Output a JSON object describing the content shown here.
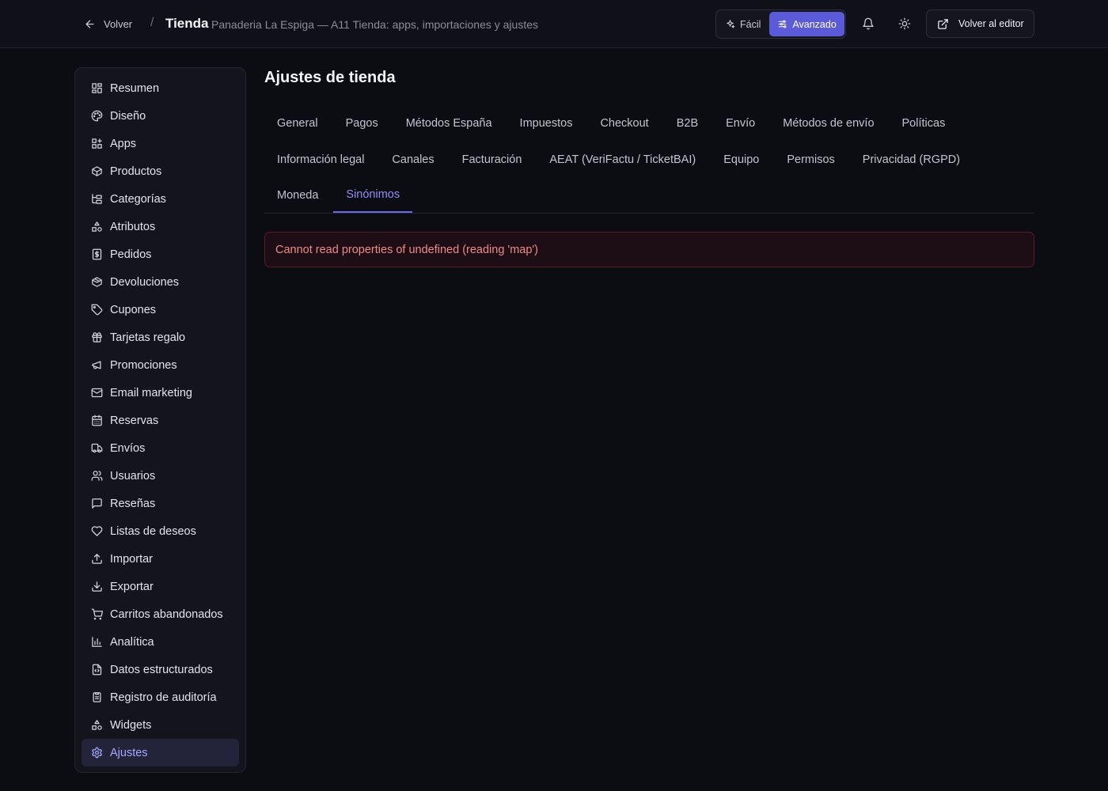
{
  "header": {
    "back_label": "Volver",
    "separator": "/",
    "title": "Tienda",
    "subtitle": "Panaderia La Espiga — A11 Tienda: apps, importaciones y ajustes",
    "mode_easy": "Fácil",
    "mode_advanced": "Avanzado",
    "editor_label": "Volver al editor",
    "accent_color": "#5b5bd9"
  },
  "sidebar": {
    "items": [
      {
        "label": "Resumen",
        "icon": "dashboard-icon"
      },
      {
        "label": "Diseño",
        "icon": "palette-icon"
      },
      {
        "label": "Apps",
        "icon": "apps-icon"
      },
      {
        "label": "Productos",
        "icon": "package-icon"
      },
      {
        "label": "Categorías",
        "icon": "category-tree-icon"
      },
      {
        "label": "Atributos",
        "icon": "shapes-icon"
      },
      {
        "label": "Pedidos",
        "icon": "receipt-icon"
      },
      {
        "label": "Devoluciones",
        "icon": "package-return-icon"
      },
      {
        "label": "Cupones",
        "icon": "tag-icon"
      },
      {
        "label": "Tarjetas regalo",
        "icon": "gift-icon"
      },
      {
        "label": "Promociones",
        "icon": "megaphone-icon"
      },
      {
        "label": "Email marketing",
        "icon": "mail-icon"
      },
      {
        "label": "Reservas",
        "icon": "calendar-icon"
      },
      {
        "label": "Envíos",
        "icon": "truck-icon"
      },
      {
        "label": "Usuarios",
        "icon": "users-icon"
      },
      {
        "label": "Reseñas",
        "icon": "message-icon"
      },
      {
        "label": "Listas de deseos",
        "icon": "heart-icon"
      },
      {
        "label": "Importar",
        "icon": "upload-icon"
      },
      {
        "label": "Exportar",
        "icon": "download-icon"
      },
      {
        "label": "Carritos abandonados",
        "icon": "cart-icon"
      },
      {
        "label": "Analítica",
        "icon": "bar-chart-icon"
      },
      {
        "label": "Datos estructurados",
        "icon": "file-code-icon"
      },
      {
        "label": "Registro de auditoría",
        "icon": "clipboard-icon"
      },
      {
        "label": "Widgets",
        "icon": "shapes-icon"
      },
      {
        "label": "Ajustes",
        "icon": "gear-icon"
      }
    ],
    "active_index": 24
  },
  "main": {
    "title": "Ajustes de tienda",
    "tabs_row1": [
      "General",
      "Pagos",
      "Métodos España",
      "Impuestos",
      "Checkout",
      "B2B",
      "Envío",
      "Métodos de envío",
      "Políticas"
    ],
    "tabs_row2": [
      "Información legal",
      "Canales",
      "Facturación",
      "AEAT (VeriFactu / TicketBAI)",
      "Equipo",
      "Permisos",
      "Privacidad (RGPD)"
    ],
    "tabs_row3": [
      "Moneda",
      "Sinónimos"
    ],
    "active_tab": "Sinónimos",
    "error_message": "Cannot read properties of undefined (reading 'map')"
  }
}
